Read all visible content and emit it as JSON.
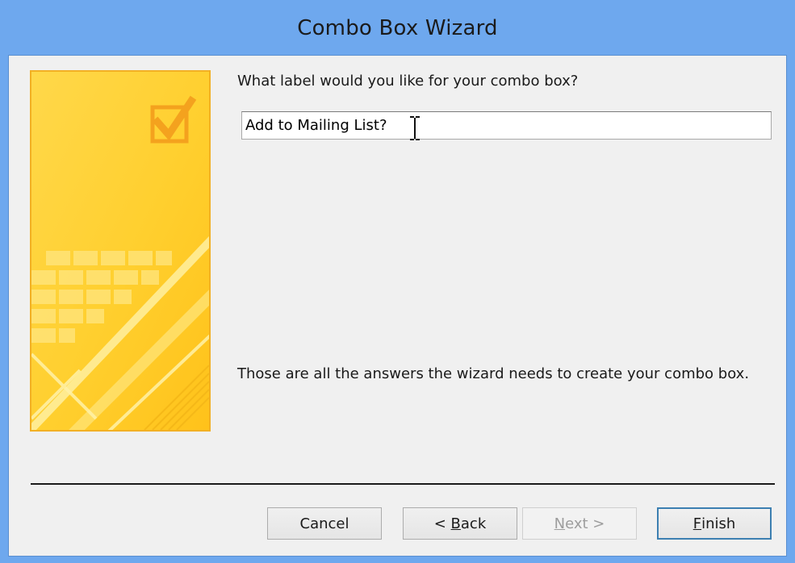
{
  "window": {
    "title": "Combo Box Wizard"
  },
  "main": {
    "prompt": "What label would you like for your combo box?",
    "label_value": "Add to Mailing List?",
    "info_text": "Those are all the answers the wizard needs to create your combo box."
  },
  "buttons": {
    "cancel": "Cancel",
    "back_prefix": "< ",
    "back_accel": "B",
    "back_rest": "ack",
    "next_accel": "N",
    "next_rest": "ext >",
    "finish_accel": "F",
    "finish_rest": "inish"
  },
  "colors": {
    "titlebar": "#6ea8ee",
    "client_bg": "#f0f0f0",
    "art_primary": "#ffd23a",
    "art_border": "#f2b024"
  },
  "icons": {
    "wizard_art": "checkbox-check-icon",
    "cursor": "text-ibeam-cursor"
  }
}
